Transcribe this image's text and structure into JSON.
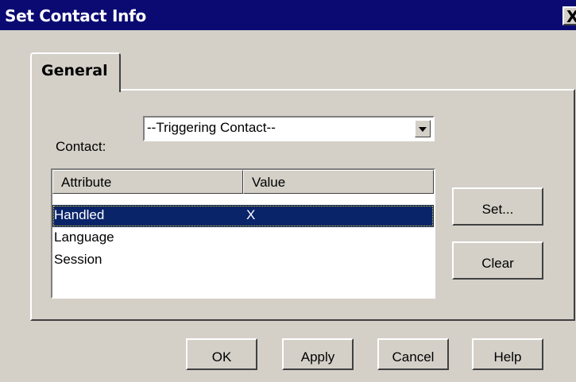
{
  "window": {
    "title": "Set Contact Info",
    "close_glyph": "X"
  },
  "tabs": [
    {
      "label": "General"
    }
  ],
  "contact": {
    "label": "Contact:",
    "selected": "--Triggering Contact--"
  },
  "list": {
    "columns": [
      "Attribute",
      "Value"
    ],
    "rows": [
      {
        "attribute": "Handled",
        "value": "X",
        "selected": true
      },
      {
        "attribute": "Language",
        "value": ""
      },
      {
        "attribute": "Session",
        "value": ""
      }
    ]
  },
  "side_buttons": {
    "set": "Set...",
    "clear": "Clear"
  },
  "footer_buttons": {
    "ok": "OK",
    "apply": "Apply",
    "cancel": "Cancel",
    "help": "Help"
  },
  "colors": {
    "titlebar": "#0a0a72",
    "selection": "#0a246a",
    "face": "#d4d0c8"
  }
}
